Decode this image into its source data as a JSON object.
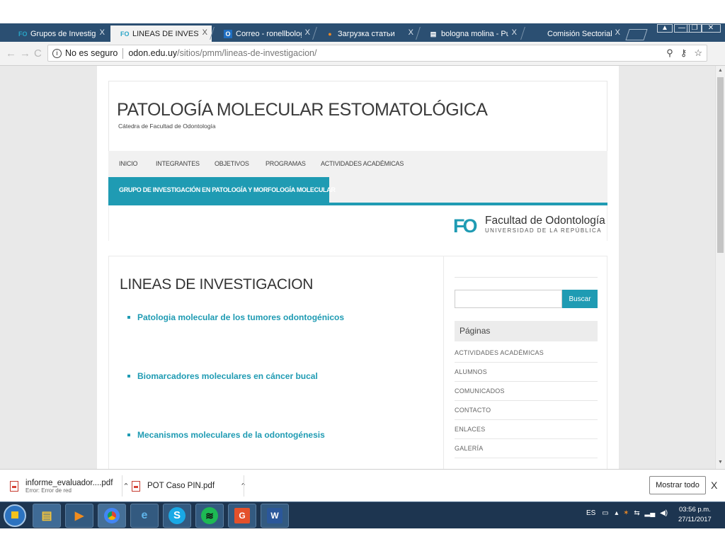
{
  "browser": {
    "tabs": [
      {
        "label": "Grupos de Investigación",
        "favicon": "FO",
        "active": false
      },
      {
        "label": "LINEAS DE INVESTIGACI",
        "favicon": "FO",
        "active": true
      },
      {
        "label": "Correo - ronellbologna@",
        "favicon": "O",
        "active": false
      },
      {
        "label": "Загрузка статьи",
        "favicon": "●",
        "active": false
      },
      {
        "label": "bologna molina - PubMe",
        "favicon": "▤",
        "active": false
      },
      {
        "label": "Comisión Sectorial de In",
        "favicon": "",
        "active": false
      }
    ],
    "tab_close_glyph": "X",
    "security_label": "No es seguro",
    "url_host": "odon.edu.uy",
    "url_path": "/sitios/pmm/lineas-de-investigacion/"
  },
  "site": {
    "title": "PATOLOGÍA MOLECULAR ESTOMATOLÓGICA",
    "description": "Cátedra de Facultad de Odontología",
    "nav": [
      "INICIO",
      "INTEGRANTES",
      "OBJETIVOS",
      "PROGRAMAS",
      "ACTIVIDADES ACADÉMICAS"
    ],
    "nav_active": "GRUPO DE INVESTIGACIÓN EN PATOLOGÍA Y MORFOLOGÍA MOLECULAR",
    "logo_mark": "FO",
    "logo_name": "Facultad de Odontología",
    "logo_sub": "UNIVERSIDAD DE LA REPÚBLICA",
    "accent_color": "#1f9bb3"
  },
  "content": {
    "heading": "LINEAS DE INVESTIGACION",
    "lines": [
      "Patologia molecular de los tumores odontogénicos",
      "Biomarcadores moleculares en cáncer bucal",
      "Mecanismos moleculares de la odontogénesis"
    ]
  },
  "sidebar": {
    "search_button": "Buscar",
    "pages_title": "Páginas",
    "pages": [
      "ACTIVIDADES ACADÉMICAS",
      "ALUMNOS",
      "COMUNICADOS",
      "CONTACTO",
      "ENLACES",
      "GALERÍA"
    ]
  },
  "downloads": {
    "items": [
      {
        "name": "informe_evaluador....pdf",
        "status": "Error: Error de red"
      },
      {
        "name": "POT Caso PIN.pdf",
        "status": ""
      }
    ],
    "show_all": "Mostrar todo",
    "close_glyph": "X"
  },
  "taskbar": {
    "language": "ES",
    "time": "03:56 p.m.",
    "date": "27/11/2017",
    "apps": [
      "explorer-icon",
      "media-player-icon",
      "chrome-icon",
      "ie-icon",
      "skype-icon",
      "spotify-icon",
      "foxit-icon",
      "word-icon"
    ]
  }
}
